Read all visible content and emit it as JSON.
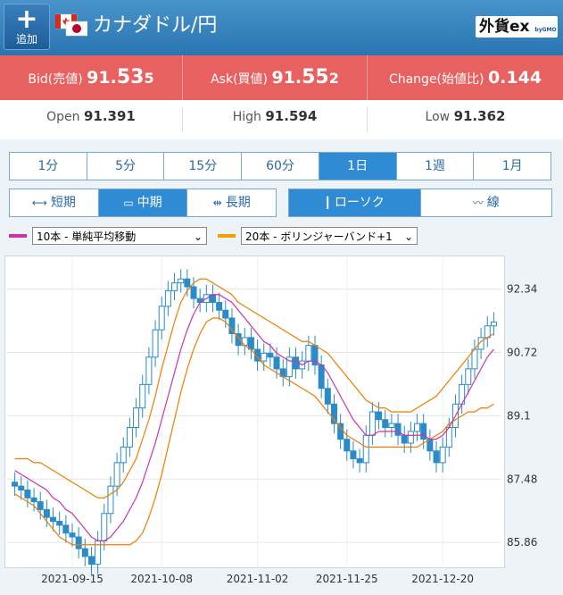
{
  "header": {
    "add_label": "追加",
    "title": "カナダドル/円",
    "brand": "外貨ex",
    "brand_sub": "byGMO",
    "bg_color": "#3584c2"
  },
  "quote": {
    "bid_label": "Bid(売値)",
    "bid_head": "91.",
    "bid_big": "53",
    "bid_tail": "5",
    "ask_label": "Ask(買値)",
    "ask_head": "91.",
    "ask_big": "55",
    "ask_tail": "2",
    "change_label": "Change(始値比)",
    "change_value": "0.144",
    "color": "#e8605f"
  },
  "stats": {
    "open_label": "Open",
    "open_value": "91.391",
    "high_label": "High",
    "high_value": "91.594",
    "low_label": "Low",
    "low_value": "91.362"
  },
  "timeframes": [
    "1分",
    "5分",
    "15分",
    "60分",
    "1日",
    "1週",
    "1月"
  ],
  "timeframe_selected": "1日",
  "periods": [
    "短期",
    "中期",
    "長期"
  ],
  "period_selected": "中期",
  "chart_types": [
    "ローソク",
    "線"
  ],
  "chart_type_selected": "ローソク",
  "indicators": {
    "ma_select": "10本 - 単純平均移動",
    "ma_color": "#cc33aa",
    "bb_select": "20本 - ボリンジャーバンド+1",
    "bb_color": "#f0a000"
  },
  "chart_data": {
    "type": "candlestick",
    "x_labels": [
      "2021-09-15",
      "2021-10-08",
      "2021-11-02",
      "2021-11-25",
      "2021-12-20"
    ],
    "y_ticks": [
      "92.34",
      "90.72",
      "89.1",
      "87.48",
      "85.86"
    ],
    "ylim": [
      85.2,
      93.2
    ],
    "grid": true,
    "close": [
      87.3,
      87.2,
      87.0,
      86.9,
      86.7,
      86.5,
      86.4,
      86.3,
      86.1,
      86.0,
      85.7,
      85.5,
      85.3,
      85.9,
      86.6,
      87.3,
      87.9,
      88.3,
      88.8,
      89.3,
      89.9,
      90.6,
      91.3,
      91.9,
      92.3,
      92.5,
      92.6,
      92.4,
      92.1,
      92.0,
      92.2,
      92.0,
      91.8,
      91.6,
      91.2,
      90.9,
      91.1,
      90.8,
      90.5,
      90.7,
      90.6,
      90.3,
      90.1,
      90.6,
      90.3,
      90.5,
      90.9,
      90.4,
      89.8,
      89.4,
      88.9,
      88.5,
      88.2,
      88.0,
      87.9,
      88.6,
      89.2,
      89.0,
      88.8,
      88.9,
      88.6,
      88.4,
      88.7,
      88.9,
      88.5,
      88.2,
      87.9,
      88.3,
      88.8,
      89.4,
      89.9,
      90.3,
      90.8,
      91.1,
      91.4,
      91.5
    ],
    "ma10": [
      87.7,
      87.6,
      87.5,
      87.4,
      87.3,
      87.2,
      87.0,
      86.9,
      86.7,
      86.6,
      86.4,
      86.2,
      86.0,
      85.9,
      85.9,
      86.0,
      86.2,
      86.4,
      86.7,
      87.0,
      87.4,
      87.9,
      88.4,
      89.0,
      89.6,
      90.2,
      90.8,
      91.3,
      91.7,
      92.0,
      92.1,
      92.2,
      92.2,
      92.1,
      92.0,
      91.8,
      91.6,
      91.4,
      91.2,
      91.0,
      90.9,
      90.7,
      90.6,
      90.5,
      90.5,
      90.4,
      90.5,
      90.5,
      90.4,
      90.2,
      89.9,
      89.6,
      89.3,
      89.0,
      88.8,
      88.6,
      88.6,
      88.7,
      88.7,
      88.7,
      88.7,
      88.6,
      88.6,
      88.6,
      88.6,
      88.5,
      88.5,
      88.6,
      88.8,
      89.1,
      89.4,
      89.7,
      90.0,
      90.3,
      90.6,
      90.8
    ],
    "bb_upper": [
      88.0,
      88.0,
      88.0,
      87.9,
      87.9,
      87.8,
      87.7,
      87.6,
      87.5,
      87.4,
      87.3,
      87.2,
      87.1,
      87.0,
      87.0,
      87.1,
      87.2,
      87.4,
      87.7,
      88.0,
      88.5,
      89.0,
      89.6,
      90.3,
      90.9,
      91.5,
      92.0,
      92.3,
      92.5,
      92.6,
      92.6,
      92.5,
      92.4,
      92.3,
      92.2,
      92.0,
      91.9,
      91.8,
      91.7,
      91.6,
      91.5,
      91.4,
      91.3,
      91.2,
      91.1,
      91.0,
      91.0,
      90.9,
      90.8,
      90.7,
      90.5,
      90.3,
      90.1,
      89.9,
      89.7,
      89.5,
      89.4,
      89.3,
      89.3,
      89.2,
      89.2,
      89.2,
      89.2,
      89.3,
      89.4,
      89.5,
      89.6,
      89.8,
      90.0,
      90.2,
      90.4,
      90.6,
      90.8,
      91.0,
      91.1,
      91.2
    ],
    "bb_lower": [
      87.1,
      87.0,
      86.9,
      86.8,
      86.6,
      86.4,
      86.2,
      86.0,
      85.9,
      85.8,
      85.8,
      85.8,
      85.8,
      85.8,
      85.8,
      85.8,
      85.8,
      85.8,
      85.8,
      85.9,
      86.1,
      86.5,
      87.0,
      87.6,
      88.3,
      89.0,
      89.7,
      90.3,
      90.8,
      91.2,
      91.5,
      91.6,
      91.6,
      91.5,
      91.3,
      91.1,
      90.9,
      90.8,
      90.6,
      90.4,
      90.3,
      90.2,
      90.1,
      90.0,
      89.9,
      89.8,
      89.7,
      89.6,
      89.4,
      89.2,
      89.0,
      88.8,
      88.6,
      88.5,
      88.4,
      88.3,
      88.3,
      88.3,
      88.3,
      88.3,
      88.3,
      88.3,
      88.3,
      88.3,
      88.4,
      88.5,
      88.6,
      88.7,
      88.9,
      89.0,
      89.1,
      89.2,
      89.2,
      89.3,
      89.3,
      89.4
    ]
  }
}
